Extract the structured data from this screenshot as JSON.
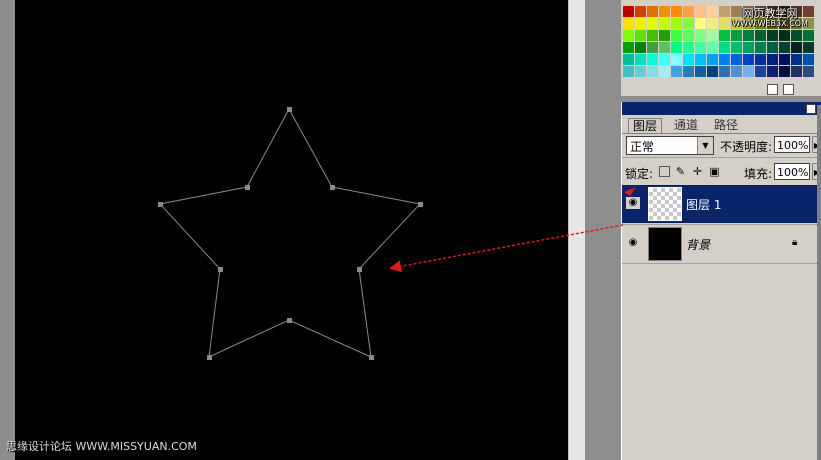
{
  "layers_panel": {
    "tabs": [
      "图层",
      "通道",
      "路径"
    ],
    "blend_mode": "正常",
    "opacity_label": "不透明度:",
    "opacity_value": "100%",
    "lock_label": "锁定:",
    "fill_label": "填充:",
    "fill_value": "100%",
    "layers": [
      {
        "name": "图层 1",
        "selected": true,
        "visible": true
      },
      {
        "name": "背景",
        "selected": false,
        "visible": true,
        "locked": true
      }
    ]
  },
  "watermarks": {
    "top_line1": "网页教学网",
    "top_line2": "WWW.WEB3X.COM",
    "bottom": "思缘设计论坛 WWW.MISSYUAN.COM"
  },
  "colors": {
    "canvas": "#000000",
    "path_stroke": "#8a8a8a",
    "arrow": "#e01a1a",
    "selected_layer": "#0a246a",
    "panel_bg": "#d4d0c8"
  },
  "icons": {
    "eye": "eye-icon",
    "lock": "lock-icon",
    "dropdown": "chevron-down-icon"
  }
}
